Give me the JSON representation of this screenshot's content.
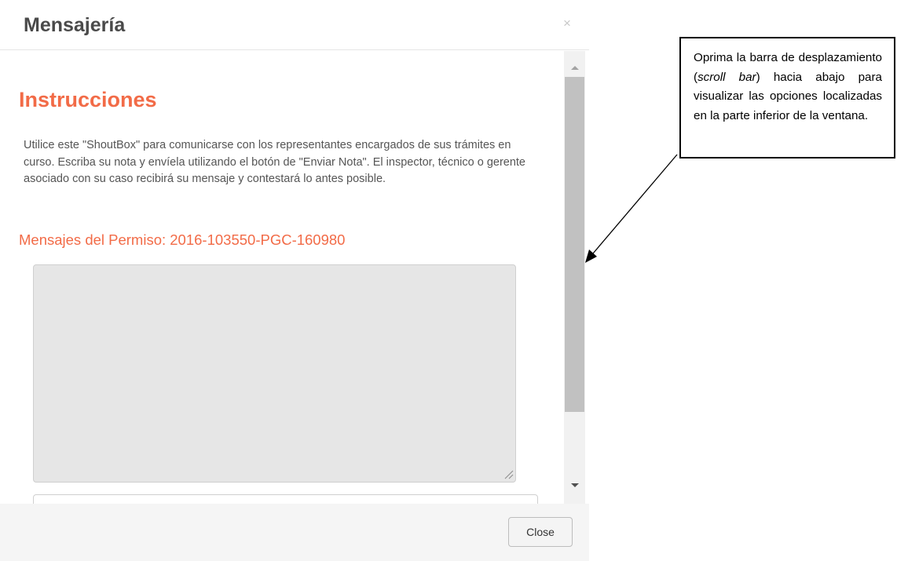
{
  "modal": {
    "title": "Mensajería",
    "close_icon": "close-icon",
    "close_glyph": "×"
  },
  "body": {
    "section_title": "Instrucciones",
    "instructions": "Utilice este \"ShoutBox\" para comunicarse con los representantes encargados de sus trámites en curso. Escriba su nota y envíela utilizando el botón de \"Enviar Nota\". El inspector, técnico o gerente asociado con su caso recibirá su mensaje y contestará lo antes posible.",
    "permit_heading": "Mensajes del Permiso: 2016-103550-PGC-160980",
    "messages_value": "",
    "note_value": ""
  },
  "scrollbar": {
    "up_icon": "triangle-up-icon",
    "down_icon": "triangle-down-icon"
  },
  "footer": {
    "close_label": "Close"
  },
  "annotation": {
    "text_before": "Oprima la barra de desplazamiento (",
    "text_italic": "scroll bar",
    "text_after": ") hacia abajo para visualizar las opciones localizadas en la parte inferior de la ventana."
  },
  "colors": {
    "accent": "#f26b47",
    "title": "#4a4a4a",
    "scroll_thumb": "#c1c1c1"
  }
}
